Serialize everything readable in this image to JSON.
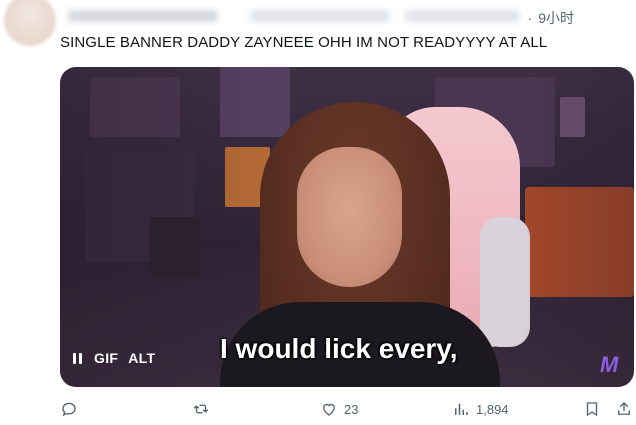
{
  "tweet": {
    "time_separator": "·",
    "time": "9小时",
    "text": "SINGLE BANNER DADDY ZAYNEEE OHH IM NOT READYYYY AT ALL"
  },
  "media": {
    "subtitle": "I would lick every,",
    "pause_icon": "pause-icon",
    "gif_label": "GIF",
    "alt_label": "ALT"
  },
  "actions": {
    "reply_icon": "reply-icon",
    "retweet_icon": "retweet-icon",
    "like_icon": "heart-icon",
    "like_count": "23",
    "views_icon": "views-icon",
    "views_count": "1,894",
    "bookmark_icon": "bookmark-icon",
    "share_icon": "share-icon"
  },
  "colors": {
    "text": "#0f1419",
    "muted": "#536471"
  }
}
